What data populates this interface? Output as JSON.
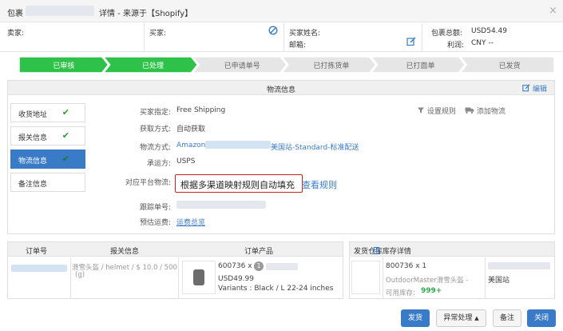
{
  "titlebar": {
    "prefix": "包裹",
    "suffix": "详情 - 来源于【Shopify】",
    "close": "×"
  },
  "info": {
    "seller_label": "卖家:",
    "buyer_label": "买家:",
    "buyer_name_label": "买家姓名:",
    "email_label": "邮箱:",
    "total_label": "包裹总额:",
    "total_value": "USD54.49",
    "profit_label": "利润:",
    "profit_value": "CNY --"
  },
  "steps": [
    "已审核",
    "已处理",
    "已申请单号",
    "已打拣货单",
    "已打面单",
    "已发货"
  ],
  "steps_done": 2,
  "colors": {
    "accent": "#3a7bc8",
    "step_done": "#2fc24a",
    "step_todo": "#e6e6e6",
    "highlight": "#cc2222"
  },
  "logistics": {
    "title": "物流信息",
    "edit": "编辑",
    "tabs": [
      {
        "label": "收货地址",
        "check": "✔"
      },
      {
        "label": "报关信息",
        "check": "✔"
      },
      {
        "label": "物流信息",
        "check": "✔"
      },
      {
        "label": "备注信息",
        "check": ""
      }
    ],
    "fields": {
      "buyer_specified_label": "买家指定:",
      "buyer_specified_value": "Free Shipping",
      "fetch_label": "获取方式:",
      "fetch_value": "自动获取",
      "method_label": "物流方式:",
      "method_value_prefix": "Amazon",
      "method_value_suffix": "美国站-Standard-标准配送",
      "carrier_label": "承运方:",
      "carrier_value": "USPS",
      "platform_label": "对应平台物流:",
      "platform_value": "根据多渠道映射规则自动填充",
      "view_rule": "查看规则",
      "tracking_label": "跟踪单号:",
      "estimate_label": "预估运费:",
      "estimate_value": "运费总览"
    },
    "set_rule": "设置规则",
    "add_logistics": "添加物流"
  },
  "order": {
    "headers": [
      "订单号",
      "报关信息",
      "订单产品"
    ],
    "customs_text_1": "滑雪头盔 / helmet / $ 10.0 / 500",
    "customs_text_2": "(g)",
    "product_qty": "600736 x",
    "product_badge": "1",
    "product_price": "USD49.99",
    "product_variants": "Variants : Black / L 22-24 inches"
  },
  "warehouse": {
    "header": "发货仓库",
    "stock_link": "库存详情",
    "item_qty": "800736 x 1",
    "item_name": "OutdoorMaster滑雪头盔 -",
    "stock_label": "可用库存:",
    "stock_value": "999+",
    "site": "美国站"
  },
  "buttons": {
    "ship": "发货",
    "exception": "异常处理",
    "remark": "备注",
    "close": "关闭"
  }
}
